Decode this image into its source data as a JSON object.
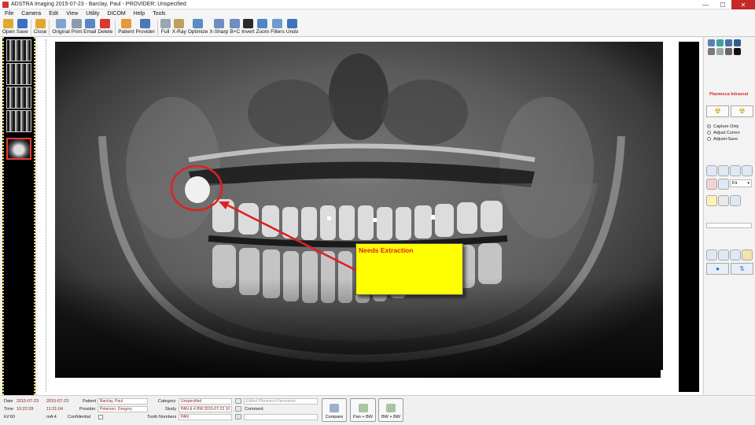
{
  "window": {
    "title": "ADSTRA Imaging 2015-07-23 - Barclay, Paul - PROVIDER: Unspecified",
    "min": "—",
    "max": "☐",
    "close": "✕"
  },
  "menu": [
    "File",
    "Camera",
    "Edit",
    "View",
    "Utility",
    "DICOM",
    "Help",
    "Tools"
  ],
  "toolbar": [
    {
      "label": "Open",
      "icon": "folder-open-icon",
      "color": "#e0a82e"
    },
    {
      "label": "Save",
      "icon": "floppy-disk-icon",
      "color": "#3b6fc4"
    },
    {
      "label": "Close",
      "icon": "close-folder-icon",
      "color": "#e0a82e"
    },
    {
      "label": "Original",
      "icon": "original-image-icon",
      "color": "#7fa3cf"
    },
    {
      "label": "Print",
      "icon": "printer-icon",
      "color": "#8c9bb0"
    },
    {
      "label": "Email",
      "icon": "email-icon",
      "color": "#5b86c5"
    },
    {
      "label": "Delete",
      "icon": "delete-x-icon",
      "color": "#d63a2f"
    },
    {
      "label": "Patient",
      "icon": "patient-icon",
      "color": "#e39a3c"
    },
    {
      "label": "Provider",
      "icon": "provider-icon",
      "color": "#4a77b8"
    },
    {
      "label": "Full",
      "icon": "grid-layout-icon",
      "color": "#9aa5b3"
    },
    {
      "label": "X-Ray",
      "icon": "xray-icon",
      "color": "#c0a060"
    },
    {
      "label": "Optimize",
      "icon": "magic-wand-icon",
      "color": "#5d8bc4"
    },
    {
      "label": "X-Sharp",
      "icon": "sharpen-icon",
      "color": "#6f8fbf"
    },
    {
      "label": "B+C",
      "icon": "brightness-contrast-icon",
      "color": "#6b8fc0"
    },
    {
      "label": "Invert",
      "icon": "invert-icon",
      "color": "#2b2b2b"
    },
    {
      "label": "Zoom",
      "icon": "zoom-icon",
      "color": "#4d86c6"
    },
    {
      "label": "Filters",
      "icon": "filters-icon",
      "color": "#6f9bd0"
    },
    {
      "label": "Undo",
      "icon": "undo-icon",
      "color": "#3d74bf"
    }
  ],
  "annotation": {
    "text": "Needs Extraction",
    "circle_color": "#e02020",
    "note_color": "#ffff00"
  },
  "right_panel": {
    "device": "Planmeca Intraoral",
    "radio": [
      "Capture Only",
      "Adjust Curren",
      "Adjust+Save"
    ],
    "selected_radio": 0,
    "fit_label": "Fit"
  },
  "bottom": {
    "date_label": "Date",
    "date1": "2015-07-23",
    "date2": "2015-07-23",
    "time_label": "Time",
    "time1": "10:22:28",
    "time2": "11:21:04",
    "kv_label": "kV:60",
    "ma_label": "mA:4",
    "patient_label": "Patient",
    "patient": "Barclay, Paul",
    "provider_label": "Provider",
    "provider": "Peterson, Gregory",
    "confidential_label": "Confidential",
    "category_label": "Category",
    "category": "Unspecified",
    "study_label": "Study",
    "study": "PAN & 4 BW 2015-07-23 10",
    "tooth_label": "Tooth Numbers",
    "tooth": "PAN",
    "edited": "Edited Planmeca Panoramic",
    "comment_label": "Comment",
    "compare": "Compare",
    "pan_bw": "Pan + BW",
    "bw_bw": "BW + BW"
  }
}
